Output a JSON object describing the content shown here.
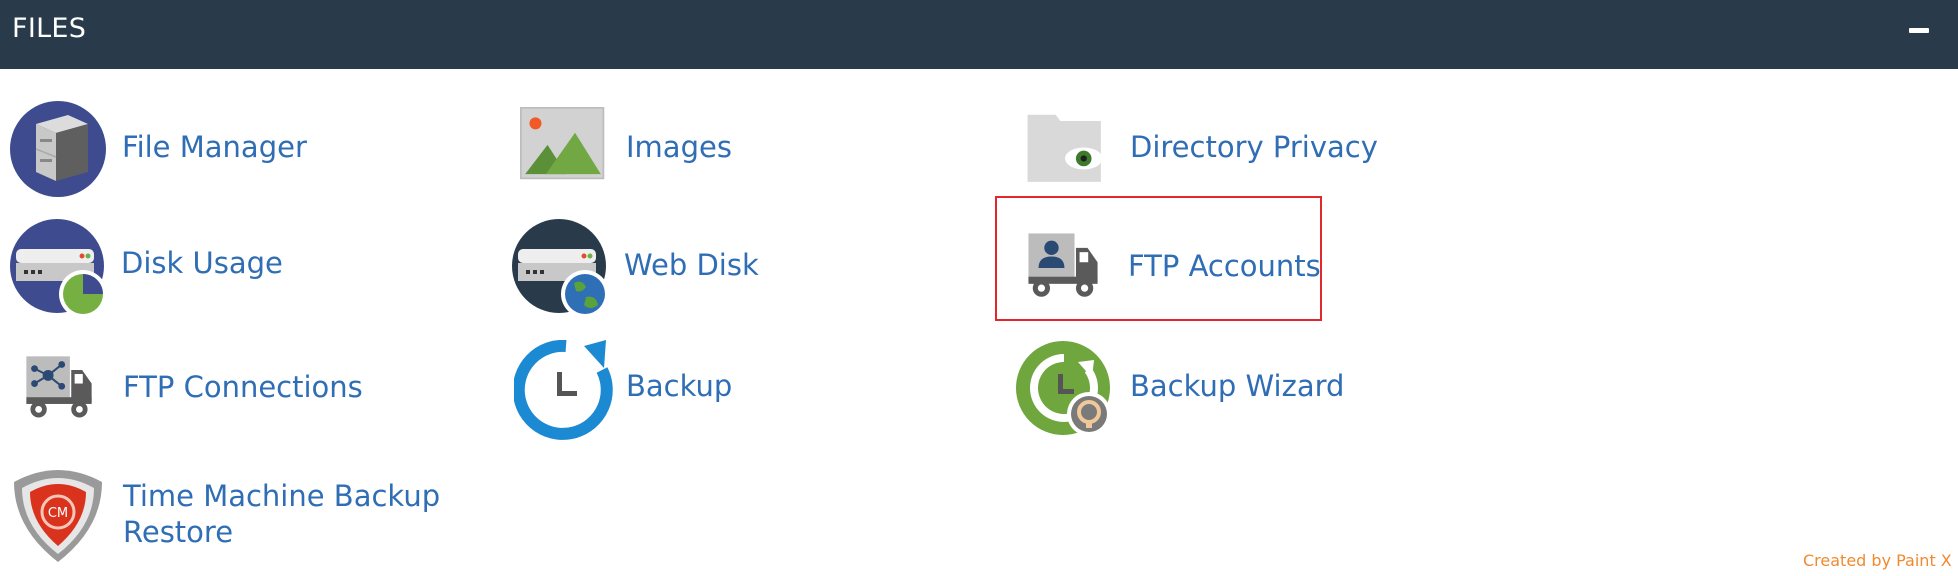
{
  "header": {
    "title": "FILES"
  },
  "items": [
    {
      "id": "file-manager",
      "label": "File Manager",
      "icon": "file-cabinet-icon"
    },
    {
      "id": "images",
      "label": "Images",
      "icon": "image-landscape-icon"
    },
    {
      "id": "directory-privacy",
      "label": "Directory Privacy",
      "icon": "folder-eye-icon"
    },
    {
      "id": "disk-usage",
      "label": "Disk Usage",
      "icon": "disk-pie-chart-icon"
    },
    {
      "id": "web-disk",
      "label": "Web Disk",
      "icon": "disk-globe-icon"
    },
    {
      "id": "ftp-accounts",
      "label": "FTP Accounts",
      "icon": "truck-user-icon",
      "highlighted": true
    },
    {
      "id": "ftp-connections",
      "label": "FTP Connections",
      "icon": "truck-network-icon"
    },
    {
      "id": "backup",
      "label": "Backup",
      "icon": "backup-clock-icon"
    },
    {
      "id": "backup-wizard",
      "label": "Backup Wizard",
      "icon": "backup-wizard-icon"
    },
    {
      "id": "time-machine",
      "label_line1": "Time Machine Backup",
      "label_line2": "Restore",
      "icon": "shield-restore-icon"
    }
  ],
  "watermark": "Created by Paint X",
  "colors": {
    "header_bg": "#293a4a",
    "link": "#2f6db5",
    "highlight": "#e2282c",
    "watermark": "#f08a2e"
  }
}
